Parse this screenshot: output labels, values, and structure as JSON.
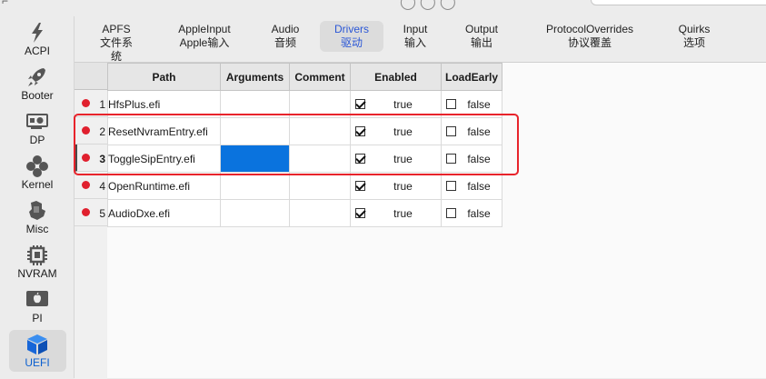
{
  "sidebar": {
    "items": [
      {
        "label": "ACPI",
        "icon": "lightning-icon"
      },
      {
        "label": "Booter",
        "icon": "rocket-icon"
      },
      {
        "label": "DP",
        "icon": "gpu-card-icon"
      },
      {
        "label": "Kernel",
        "icon": "kernel-icon"
      },
      {
        "label": "Misc",
        "icon": "puzzle-icon"
      },
      {
        "label": "NVRAM",
        "icon": "chip-icon"
      },
      {
        "label": "PI",
        "icon": "apple-logo-icon"
      },
      {
        "label": "UEFI",
        "icon": "cube-icon"
      }
    ],
    "selected": "UEFI"
  },
  "tabs": [
    {
      "en": "APFS",
      "zh": "文件系统"
    },
    {
      "en": "AppleInput",
      "zh": "Apple输入"
    },
    {
      "en": "Audio",
      "zh": "音频"
    },
    {
      "en": "Drivers",
      "zh": "驱动"
    },
    {
      "en": "Input",
      "zh": "输入"
    },
    {
      "en": "Output",
      "zh": "输出"
    },
    {
      "en": "ProtocolOverrides",
      "zh": "协议覆盖"
    },
    {
      "en": "Quirks",
      "zh": "选项"
    }
  ],
  "active_tab": "Drivers",
  "table": {
    "columns": [
      "Path",
      "Arguments",
      "Comment",
      "Enabled",
      "LoadEarly"
    ],
    "rows": [
      {
        "num": "1",
        "path": "HfsPlus.efi",
        "arguments": "",
        "comment": "",
        "enabled": "true",
        "load_early": "false"
      },
      {
        "num": "2",
        "path": "ResetNvramEntry.efi",
        "arguments": "",
        "comment": "",
        "enabled": "true",
        "load_early": "false"
      },
      {
        "num": "3",
        "path": "ToggleSipEntry.efi",
        "arguments": "",
        "comment": "",
        "enabled": "true",
        "load_early": "false"
      },
      {
        "num": "4",
        "path": "OpenRuntime.efi",
        "arguments": "",
        "comment": "",
        "enabled": "true",
        "load_early": "false"
      },
      {
        "num": "5",
        "path": "AudioDxe.efi",
        "arguments": "",
        "comment": "",
        "enabled": "true",
        "load_early": "false"
      }
    ],
    "current_row": "3"
  },
  "colors": {
    "accent": "#0a73de",
    "highlight_box": "#e8232b",
    "row_dot": "#e0202e"
  }
}
